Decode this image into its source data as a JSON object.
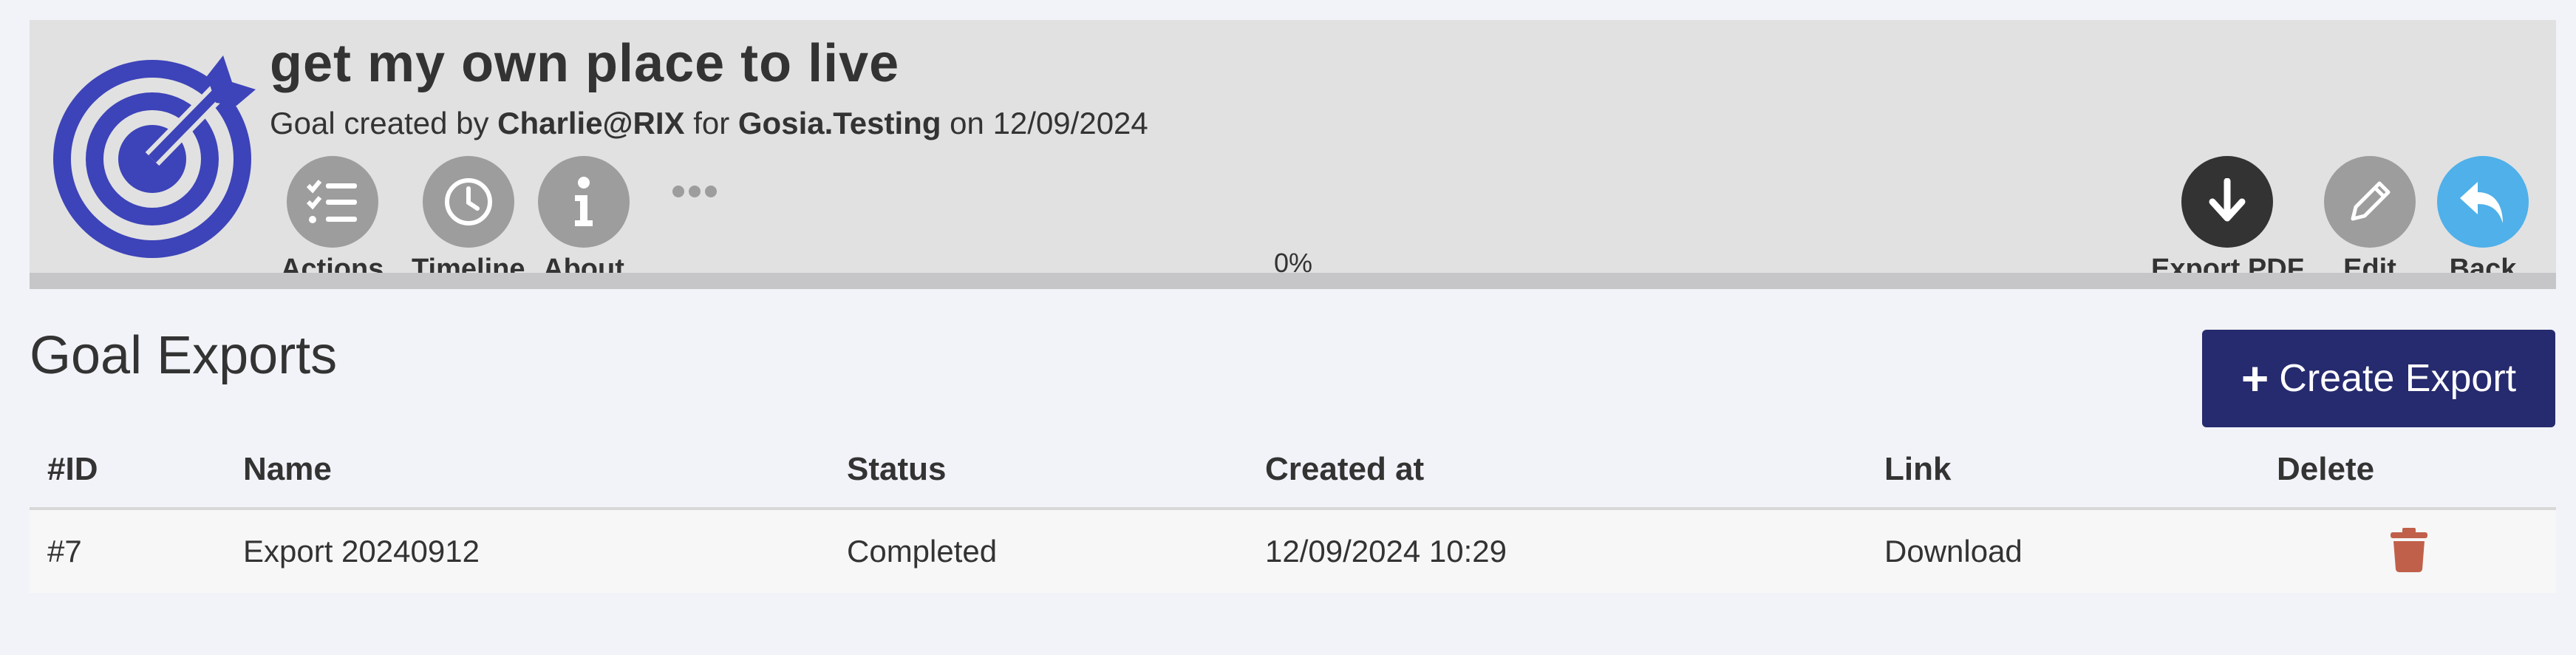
{
  "goal": {
    "title": "get my own place to live",
    "sub_prefix": "Goal created by ",
    "creator": "Charlie@RIX",
    "sub_for": " for ",
    "owner": "Gosia.Testing",
    "sub_on": " on ",
    "date": "12/09/2024",
    "progress": "0%",
    "progress_fraction": 0
  },
  "toolbar_left": [
    {
      "label": "Actions",
      "icon": "checklist-icon"
    },
    {
      "label": "Timeline",
      "icon": "clock-icon"
    },
    {
      "label": "About",
      "icon": "info-icon"
    }
  ],
  "more_icon": "more-dots-icon",
  "toolbar_right": [
    {
      "label": "Export PDF",
      "icon": "download-arrow-icon"
    },
    {
      "label": "Edit",
      "icon": "pencil-icon"
    },
    {
      "label": "Back",
      "icon": "reply-arrow-icon"
    }
  ],
  "section": {
    "title": "Goal Exports",
    "create_label": "Create Export"
  },
  "table": {
    "headers": [
      "#ID",
      "Name",
      "Status",
      "Created at",
      "Link",
      "Delete"
    ],
    "rows": [
      {
        "id": "#7",
        "name": "Export 20240912",
        "status": "Completed",
        "created_at": "12/09/2024 10:29",
        "link": "Download",
        "delete_icon": "trash-icon"
      }
    ]
  },
  "colors": {
    "brand_blue": "#3d43b8",
    "create_button": "#262a6e",
    "back_button": "#4fb0ea",
    "export_button": "#333333",
    "tool_grey": "#9d9d9d",
    "delete_red": "#c0604a"
  }
}
